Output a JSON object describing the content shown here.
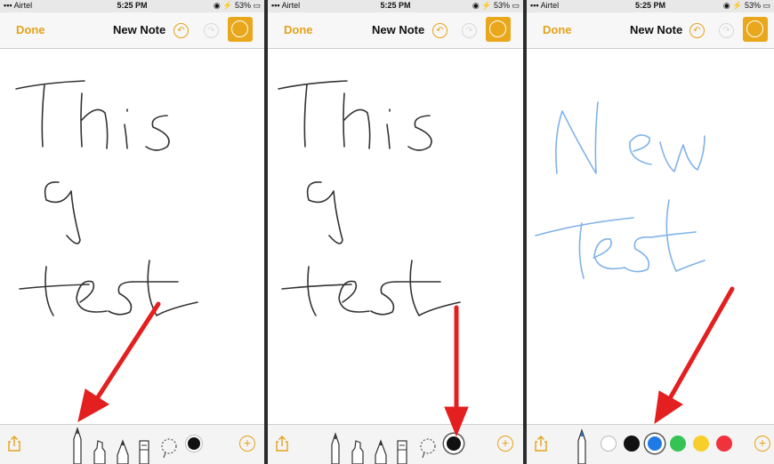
{
  "status": {
    "carrier": "Airtel",
    "time": "5:25 PM",
    "battery": "53%"
  },
  "nav": {
    "done_label": "Done",
    "title": "New Note"
  },
  "panels": [
    {
      "handwriting": [
        "This",
        "a",
        "test"
      ],
      "ink_color": "#333333",
      "selected_tool": "pen"
    },
    {
      "handwriting": [
        "This",
        "a",
        "test"
      ],
      "ink_color": "#333333",
      "selected_tool": "color-black"
    },
    {
      "handwriting": [
        "New",
        "Test"
      ],
      "ink_color": "#7fb2ea",
      "selected_tool": "color-blue"
    }
  ],
  "palette": {
    "colors": [
      "#ffffff",
      "#111111",
      "#1f7ae6",
      "#36c356",
      "#f7cf2a",
      "#f0323c"
    ]
  },
  "colors": {
    "accent": "#e9a71b",
    "arrow": "#e41f1f"
  },
  "icons": [
    "share-icon",
    "pen-icon",
    "marker-icon",
    "pencil-icon",
    "eraser-icon",
    "lasso-icon",
    "plus-icon",
    "undo-icon",
    "redo-icon",
    "markup-icon"
  ]
}
